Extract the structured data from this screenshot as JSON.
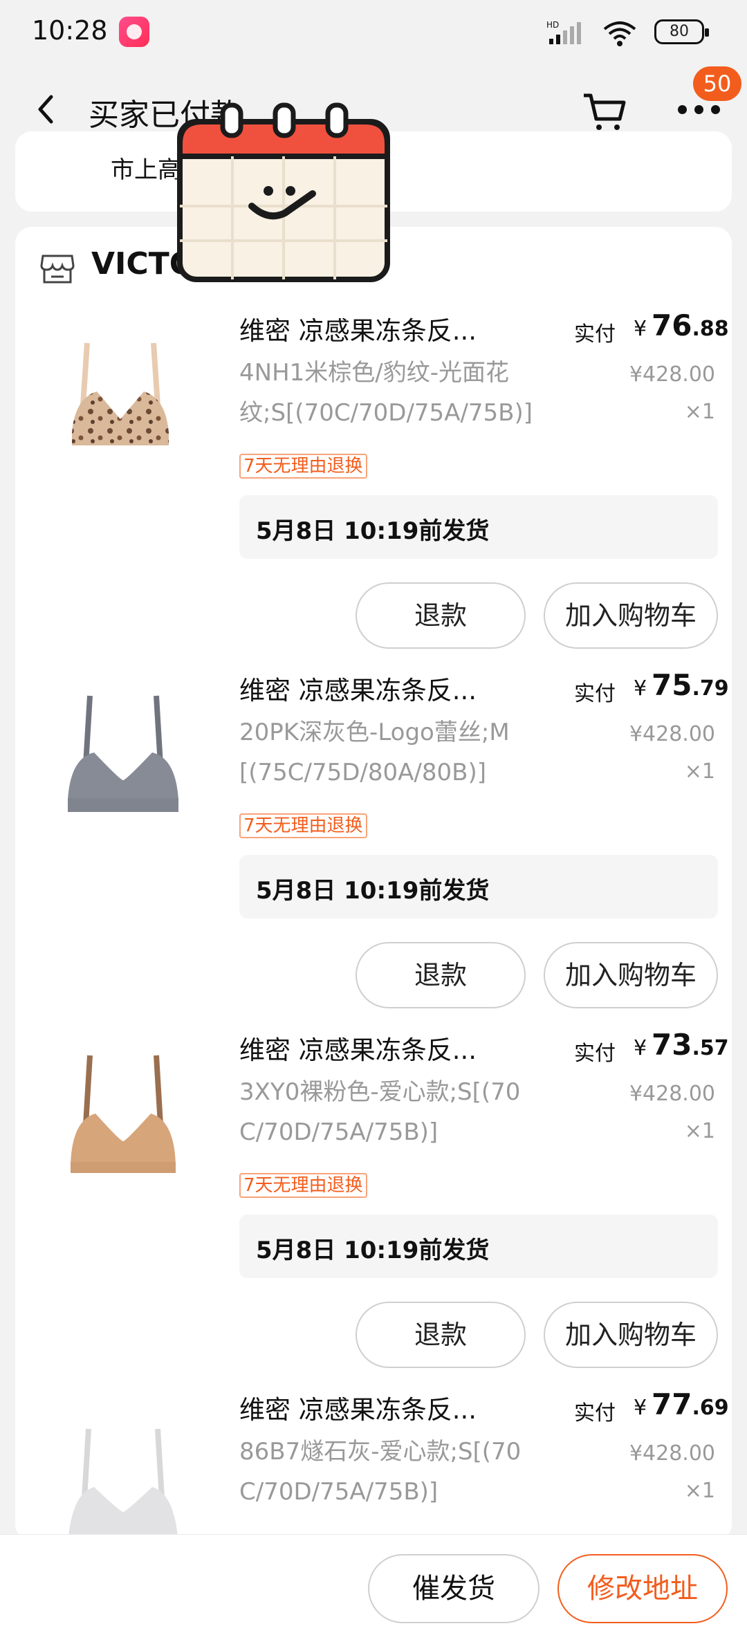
{
  "status_bar": {
    "time": "10:28",
    "signal": "HD",
    "battery": "80"
  },
  "nav": {
    "title": "买家已付款",
    "notification_count": "50"
  },
  "address": {
    "text": "市上高"
  },
  "store": {
    "name": "VICTO"
  },
  "items": [
    {
      "title": "维密 凉感果冻条反...",
      "spec_line1": "4NH1米棕色/豹纹-光面花",
      "spec_line2": "纹;S[(70C/70D/75A/75B)]",
      "tag": "7天无理由退换",
      "price_label": "实付",
      "price_currency": "¥",
      "price_int": "76",
      "price_dec": ".88",
      "original_price": "¥428.00",
      "qty": "×1",
      "shipping": "5月8日 10:19前发货",
      "refund": "退款",
      "add_cart": "加入购物车"
    },
    {
      "title": "维密 凉感果冻条反...",
      "spec_line1": "20PK深灰色-Logo蕾丝;M",
      "spec_line2": "[(75C/75D/80A/80B)]",
      "tag": "7天无理由退换",
      "price_label": "实付",
      "price_currency": "¥",
      "price_int": "75",
      "price_dec": ".79",
      "original_price": "¥428.00",
      "qty": "×1",
      "shipping": "5月8日 10:19前发货",
      "refund": "退款",
      "add_cart": "加入购物车"
    },
    {
      "title": "维密 凉感果冻条反...",
      "spec_line1": "3XY0裸粉色-爱心款;S[(70",
      "spec_line2": "C/70D/75A/75B)]",
      "tag": "7天无理由退换",
      "price_label": "实付",
      "price_currency": "¥",
      "price_int": "73",
      "price_dec": ".57",
      "original_price": "¥428.00",
      "qty": "×1",
      "shipping": "5月8日 10:19前发货",
      "refund": "退款",
      "add_cart": "加入购物车"
    },
    {
      "title": "维密 凉感果冻条反...",
      "spec_line1": "86B7燧石灰-爱心款;S[(70",
      "spec_line2": "C/70D/75A/75B)]",
      "tag": "",
      "price_label": "实付",
      "price_currency": "¥",
      "price_int": "77",
      "price_dec": ".69",
      "original_price": "¥428.00",
      "qty": "×1",
      "shipping": "",
      "refund": "",
      "add_cart": ""
    }
  ],
  "bottom": {
    "urge_ship": "催发货",
    "modify_address": "修改地址"
  },
  "colors": {
    "accent": "#f25d1d",
    "background": "#f2f2f2",
    "muted_text": "#999999"
  },
  "icons": {
    "back": "chevron-left-icon",
    "cart": "cart-icon",
    "more": "more-icon",
    "store": "store-icon",
    "calendar": "calendar-sticker-icon"
  }
}
